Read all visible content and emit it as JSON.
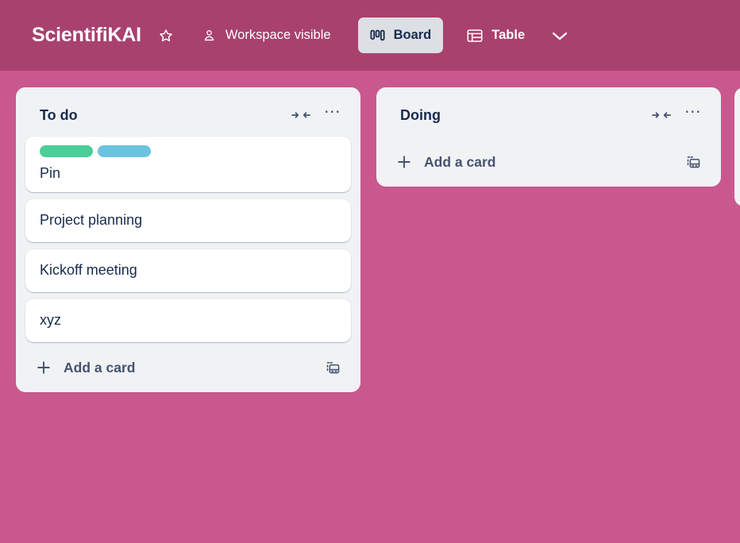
{
  "header": {
    "board_title": "ScientifiKAI",
    "star_icon": "star-outline-icon",
    "visibility_icon": "person-outline-icon",
    "visibility_label": "Workspace visible",
    "views": [
      {
        "label": "Board",
        "icon": "board-columns-icon",
        "active": true
      },
      {
        "label": "Table",
        "icon": "table-grid-icon",
        "active": false
      }
    ],
    "more_views_icon": "chevron-down-icon",
    "bg_color": "#a8416e",
    "text_color": "#ffffff",
    "active_view_bg": "#dcdfe4",
    "active_view_text": "#172b4d"
  },
  "board": {
    "bg_color": "#c9588e",
    "list_bg_color": "#f1f2f4",
    "card_bg_color": "#ffffff",
    "text_color": "#172b4d",
    "subtle_text_color": "#44546f",
    "lists": [
      {
        "title": "To do",
        "collapse_icon": "collapse-arrows-icon",
        "menu_icon": "list-actions-ellipsis-icon",
        "cards": [
          {
            "title": "Pin",
            "labels": [
              {
                "name": "green-label",
                "color": "#4bce97"
              },
              {
                "name": "blue-label",
                "color": "#6cc3e0"
              }
            ]
          },
          {
            "title": "Project planning",
            "labels": []
          },
          {
            "title": "Kickoff meeting",
            "labels": []
          },
          {
            "title": "xyz",
            "labels": []
          }
        ],
        "add_card_label": "Add a card",
        "add_card_icon": "plus-icon",
        "template_icon": "card-template-icon"
      },
      {
        "title": "Doing",
        "collapse_icon": "collapse-arrows-icon",
        "menu_icon": "list-actions-ellipsis-icon",
        "cards": [],
        "add_card_label": "Add a card",
        "add_card_icon": "plus-icon",
        "template_icon": "card-template-icon"
      }
    ]
  }
}
